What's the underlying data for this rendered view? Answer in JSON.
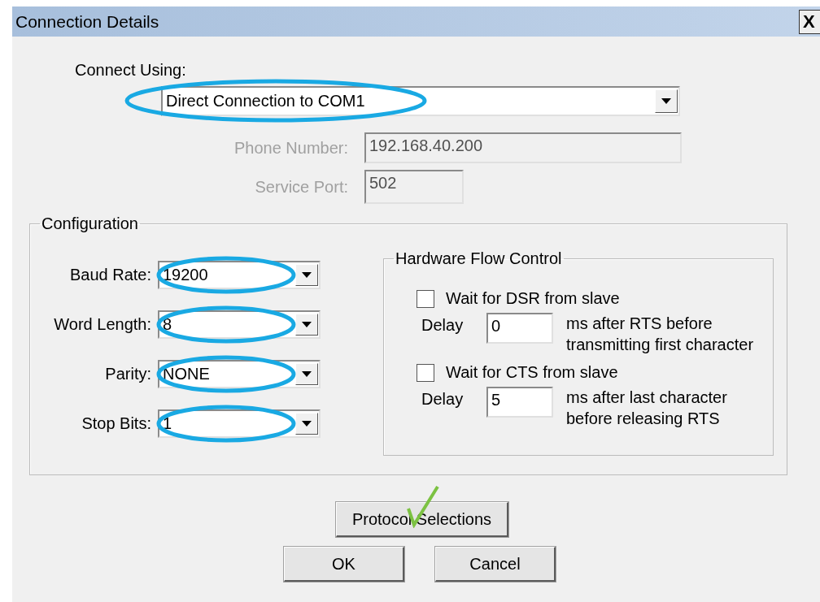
{
  "window": {
    "title": "Connection Details",
    "close_label": "X"
  },
  "connect_using": {
    "label": "Connect Using:",
    "value": "Direct Connection to COM1",
    "highlighted": true
  },
  "phone_number": {
    "label": "Phone Number:",
    "value": "192.168.40.200",
    "disabled": true
  },
  "service_port": {
    "label": "Service Port:",
    "value": "502",
    "disabled": true
  },
  "configuration": {
    "title": "Configuration",
    "fields": [
      {
        "label": "Baud Rate:",
        "value": "19200",
        "highlighted": true
      },
      {
        "label": "Word Length:",
        "value": "8",
        "highlighted": true
      },
      {
        "label": "Parity:",
        "value": "NONE",
        "highlighted": true
      },
      {
        "label": "Stop Bits:",
        "value": "1",
        "highlighted": true
      }
    ]
  },
  "hardware_flow_control": {
    "title": "Hardware Flow Control",
    "options": [
      {
        "label": "Wait for DSR from slave",
        "checked": false,
        "delay_label": "Delay",
        "delay": "0",
        "note": [
          "ms after RTS before",
          "transmitting first character"
        ]
      },
      {
        "label": "Wait for CTS from slave",
        "checked": false,
        "delay_label": "Delay",
        "delay": "5",
        "note": [
          "ms after last character",
          "before releasing RTS"
        ]
      }
    ]
  },
  "buttons": [
    {
      "label": "Protocol Selections",
      "kind": "wide",
      "check_annotation": true
    },
    {
      "label": "OK",
      "kind": "normal",
      "check_annotation": false
    },
    {
      "label": "Cancel",
      "kind": "normal",
      "check_annotation": false
    }
  ]
}
